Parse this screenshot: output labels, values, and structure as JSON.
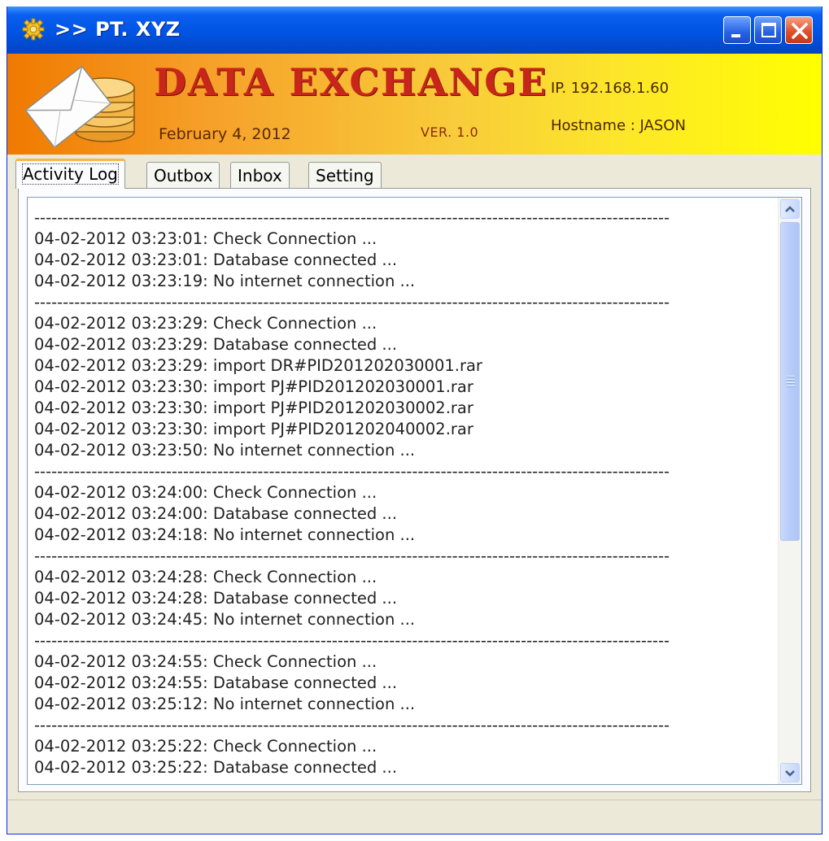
{
  "window": {
    "title": ">> PT. XYZ",
    "icon": "gear-icon"
  },
  "banner": {
    "app_name": "DATA EXCHANGE",
    "date": "February 4, 2012",
    "version": "VER. 1.0",
    "ip": "IP. 192.168.1.60",
    "hostname": "Hostname : JASON"
  },
  "tabs": [
    {
      "label": "Activity Log",
      "active": true
    },
    {
      "label": "Outbox",
      "active": false
    },
    {
      "label": "Inbox",
      "active": false
    },
    {
      "label": "Setting",
      "active": false
    }
  ],
  "log": {
    "separator": "---------------------------------------------------------------------------------------------------------------",
    "groups": [
      [
        "04-02-2012 03:23:01: Check Connection ...",
        "04-02-2012 03:23:01: Database connected ...",
        "04-02-2012 03:23:19: No internet connection ..."
      ],
      [
        "04-02-2012 03:23:29: Check Connection ...",
        "04-02-2012 03:23:29: Database connected ...",
        "04-02-2012 03:23:29: import DR#PID201202030001.rar",
        "04-02-2012 03:23:30: import PJ#PID201202030001.rar",
        "04-02-2012 03:23:30: import PJ#PID201202030002.rar",
        "04-02-2012 03:23:30: import PJ#PID201202040002.rar",
        "04-02-2012 03:23:50: No internet connection ..."
      ],
      [
        "04-02-2012 03:24:00: Check Connection ...",
        "04-02-2012 03:24:00: Database connected ...",
        "04-02-2012 03:24:18: No internet connection ..."
      ],
      [
        "04-02-2012 03:24:28: Check Connection ...",
        "04-02-2012 03:24:28: Database connected ...",
        "04-02-2012 03:24:45: No internet connection ..."
      ],
      [
        "04-02-2012 03:24:55: Check Connection ...",
        "04-02-2012 03:24:55: Database connected ...",
        "04-02-2012 03:25:12: No internet connection ..."
      ],
      [
        "04-02-2012 03:25:22: Check Connection ...",
        "04-02-2012 03:25:22: Database connected ..."
      ]
    ]
  },
  "colors": {
    "titlebar": "#0054e3",
    "banner_start": "#f07a00",
    "banner_end": "#ffff00",
    "app_name": "#c8261a",
    "window_bg": "#ece9d8"
  }
}
